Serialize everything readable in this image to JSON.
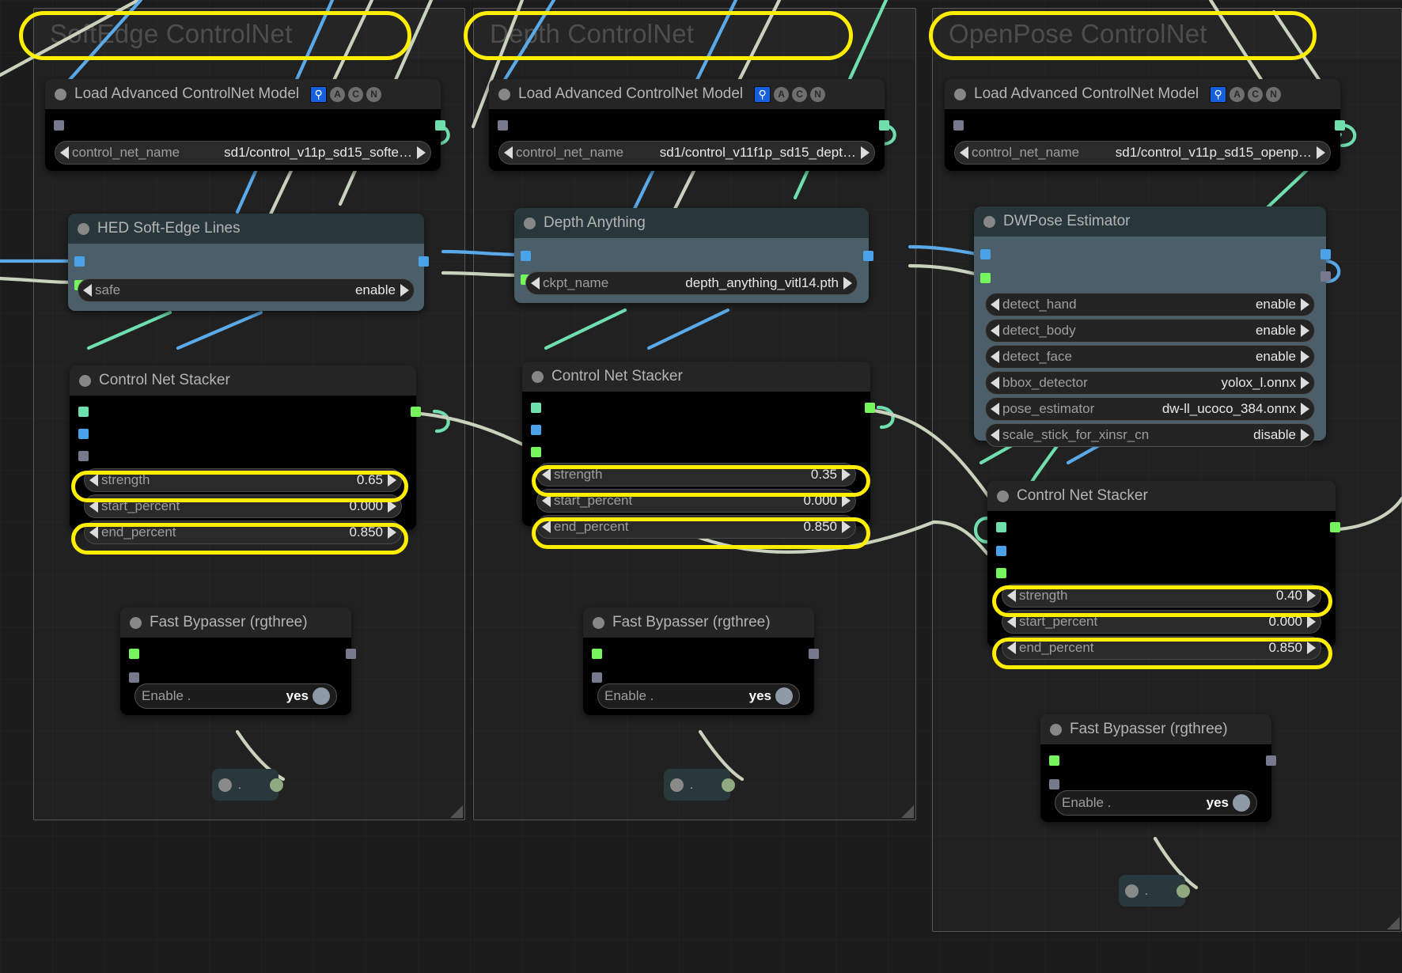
{
  "groups": [
    {
      "title": "SoftEdge ControlNet",
      "highlighted": true
    },
    {
      "title": "Depth ControlNet",
      "highlighted": true
    },
    {
      "title": "OpenPose ControlNet",
      "highlighted": true
    }
  ],
  "badges": {
    "blue_icon": "node-map-icon",
    "circles": [
      "A",
      "C",
      "N"
    ]
  },
  "nodes": {
    "softedge_loader": {
      "title": "Load Advanced ControlNet Model",
      "widgets": [
        {
          "label": "control_net_name",
          "value": "sd1/control_v11p_sd15_softe…"
        }
      ]
    },
    "depth_loader": {
      "title": "Load Advanced ControlNet Model",
      "widgets": [
        {
          "label": "control_net_name",
          "value": "sd1/control_v11f1p_sd15_dept…"
        }
      ]
    },
    "openpose_loader": {
      "title": "Load Advanced ControlNet Model",
      "widgets": [
        {
          "label": "control_net_name",
          "value": "sd1/control_v11p_sd15_openp…"
        }
      ]
    },
    "hed": {
      "title": "HED Soft-Edge Lines",
      "widgets": [
        {
          "label": "safe",
          "value": "enable"
        }
      ]
    },
    "depth_anything": {
      "title": "Depth Anything",
      "widgets": [
        {
          "label": "ckpt_name",
          "value": "depth_anything_vitl14.pth"
        }
      ]
    },
    "dwpose": {
      "title": "DWPose Estimator",
      "widgets": [
        {
          "label": "detect_hand",
          "value": "enable"
        },
        {
          "label": "detect_body",
          "value": "enable"
        },
        {
          "label": "detect_face",
          "value": "enable"
        },
        {
          "label": "bbox_detector",
          "value": "yolox_l.onnx"
        },
        {
          "label": "pose_estimator",
          "value": "dw-ll_ucoco_384.onnx"
        },
        {
          "label": "scale_stick_for_xinsr_cn",
          "value": "disable"
        }
      ]
    },
    "stacker_softedge": {
      "title": "Control Net Stacker",
      "widgets": [
        {
          "label": "strength",
          "value": "0.65",
          "highlighted": true
        },
        {
          "label": "start_percent",
          "value": "0.000",
          "highlighted": false
        },
        {
          "label": "end_percent",
          "value": "0.850",
          "highlighted": true
        }
      ]
    },
    "stacker_depth": {
      "title": "Control Net Stacker",
      "widgets": [
        {
          "label": "strength",
          "value": "0.35",
          "highlighted": true
        },
        {
          "label": "start_percent",
          "value": "0.000",
          "highlighted": false
        },
        {
          "label": "end_percent",
          "value": "0.850",
          "highlighted": true
        }
      ]
    },
    "stacker_openpose": {
      "title": "Control Net Stacker",
      "widgets": [
        {
          "label": "strength",
          "value": "0.40",
          "highlighted": true
        },
        {
          "label": "start_percent",
          "value": "0.000",
          "highlighted": false
        },
        {
          "label": "end_percent",
          "value": "0.850",
          "highlighted": true
        }
      ]
    },
    "bypasser_softedge": {
      "title": "Fast Bypasser (rgthree)",
      "widgets": [
        {
          "label": "Enable .",
          "value": "yes"
        }
      ]
    },
    "bypasser_depth": {
      "title": "Fast Bypasser (rgthree)",
      "widgets": [
        {
          "label": "Enable .",
          "value": "yes"
        }
      ]
    },
    "bypasser_openpose": {
      "title": "Fast Bypasser (rgthree)",
      "widgets": [
        {
          "label": "Enable .",
          "value": "yes"
        }
      ]
    },
    "reroute_softedge": {
      "label": "."
    },
    "reroute_depth": {
      "label": "."
    },
    "reroute_openpose": {
      "label": "."
    }
  },
  "colors": {
    "highlight": "#ffee00",
    "canvas": "#1c1c1c",
    "node_dark_title": "#252525",
    "node_dark_body": "#000000",
    "node_teal_title": "#28373c",
    "node_teal_body": "#4a5f6a",
    "wire_image": "#9ec3e8",
    "wire_mint": "#6fdfae",
    "wire_gray": "#c9d2bd"
  }
}
